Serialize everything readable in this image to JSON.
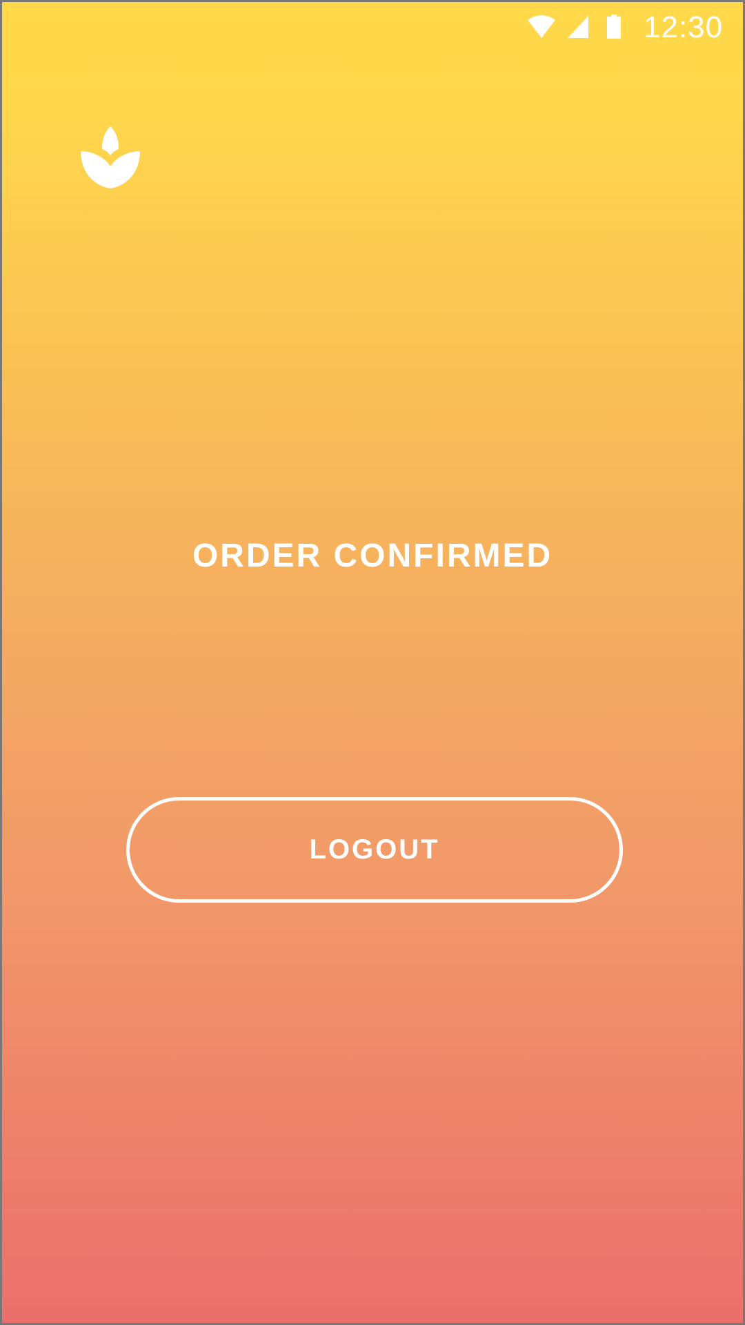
{
  "status_bar": {
    "time": "12:30",
    "icons": [
      "wifi-icon",
      "cellular-signal-icon",
      "battery-icon"
    ]
  },
  "logo": {
    "icon": "leaf-sprout-logo"
  },
  "main": {
    "title": "ORDER CONFIRMED",
    "logout_label": "LOGOUT"
  },
  "colors": {
    "gradient_top": "#FFD94A",
    "gradient_bottom": "#EB6F6B",
    "foreground": "#FFFFFF"
  }
}
